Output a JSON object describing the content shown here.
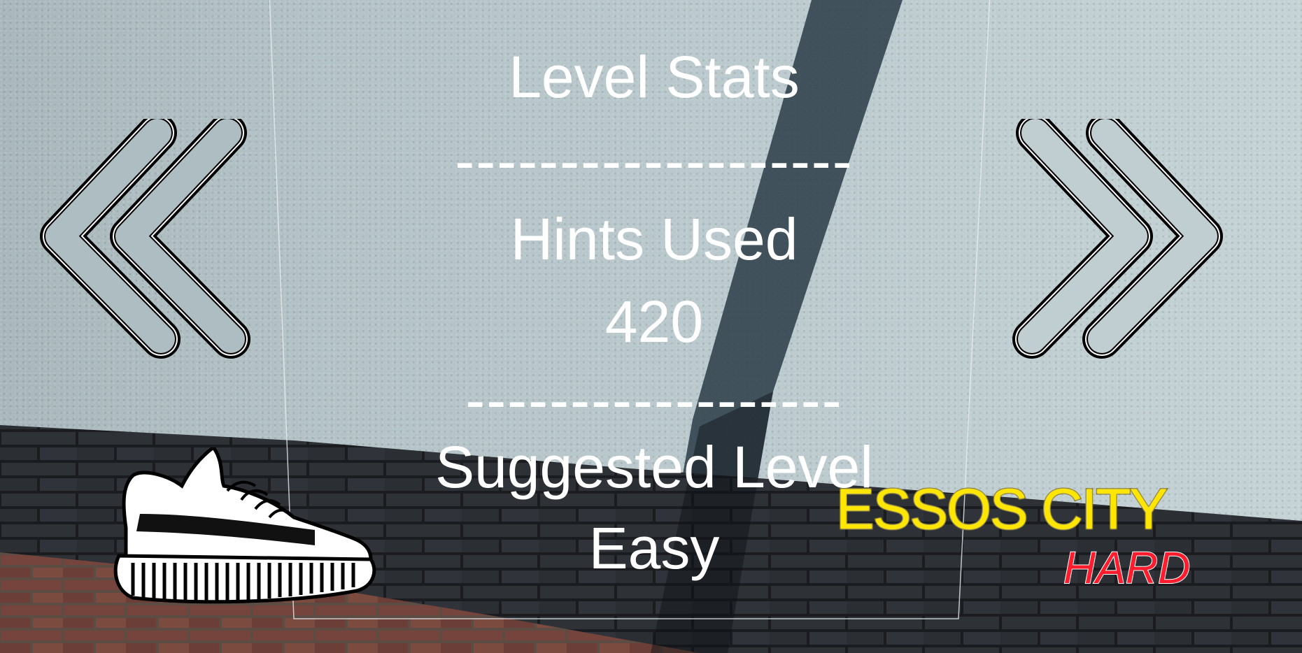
{
  "level_stats": {
    "title": "Level Stats",
    "divider_1": "-------------------",
    "hints_label": "Hints Used",
    "hints_value": "420",
    "divider_2": "------------------",
    "suggested_label": "Suggested Level",
    "suggested_value": "Easy"
  },
  "navigation": {
    "prev_icon": "double-chevron-left-icon",
    "next_icon": "double-chevron-right-icon"
  },
  "level_select": {
    "city_name": "ESSOS CITY",
    "difficulty": "HARD",
    "logo_icon": "sneaker-icon",
    "colors": {
      "city_name": "#ffe600",
      "difficulty": "#ff1c2c"
    }
  }
}
